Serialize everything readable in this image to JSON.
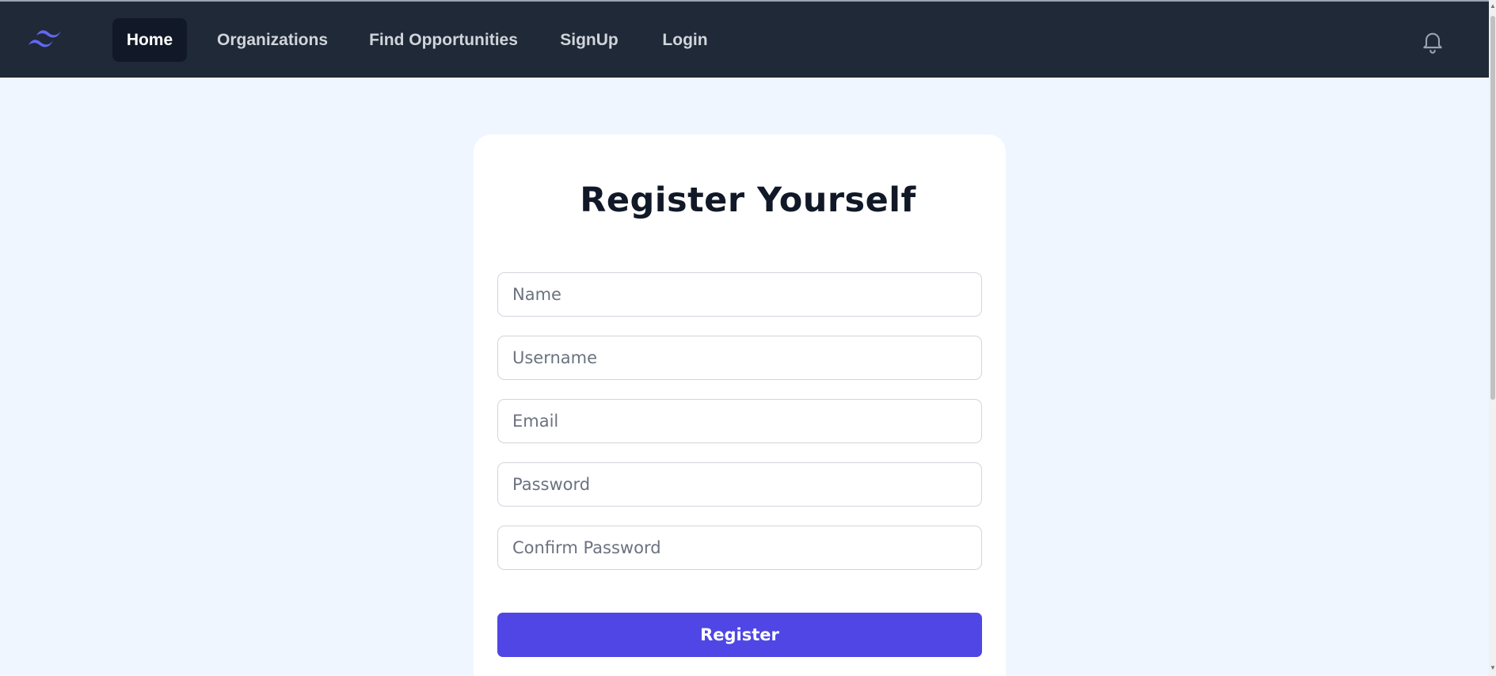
{
  "nav": {
    "logo_icon": "tailwind-wave-icon",
    "accent_color": "#6366f1",
    "links": [
      {
        "label": "Home",
        "active": true
      },
      {
        "label": "Organizations",
        "active": false
      },
      {
        "label": "Find Opportunities",
        "active": false
      },
      {
        "label": "SignUp",
        "active": false
      },
      {
        "label": "Login",
        "active": false
      }
    ],
    "notification_icon": "bell-icon"
  },
  "form": {
    "title": "Register Yourself",
    "fields": [
      {
        "placeholder": "Name",
        "value": ""
      },
      {
        "placeholder": "Username",
        "value": ""
      },
      {
        "placeholder": "Email",
        "value": ""
      },
      {
        "placeholder": "Password",
        "value": ""
      },
      {
        "placeholder": "Confirm Password",
        "value": ""
      }
    ],
    "submit_label": "Register",
    "submit_color": "#4f46e5"
  }
}
